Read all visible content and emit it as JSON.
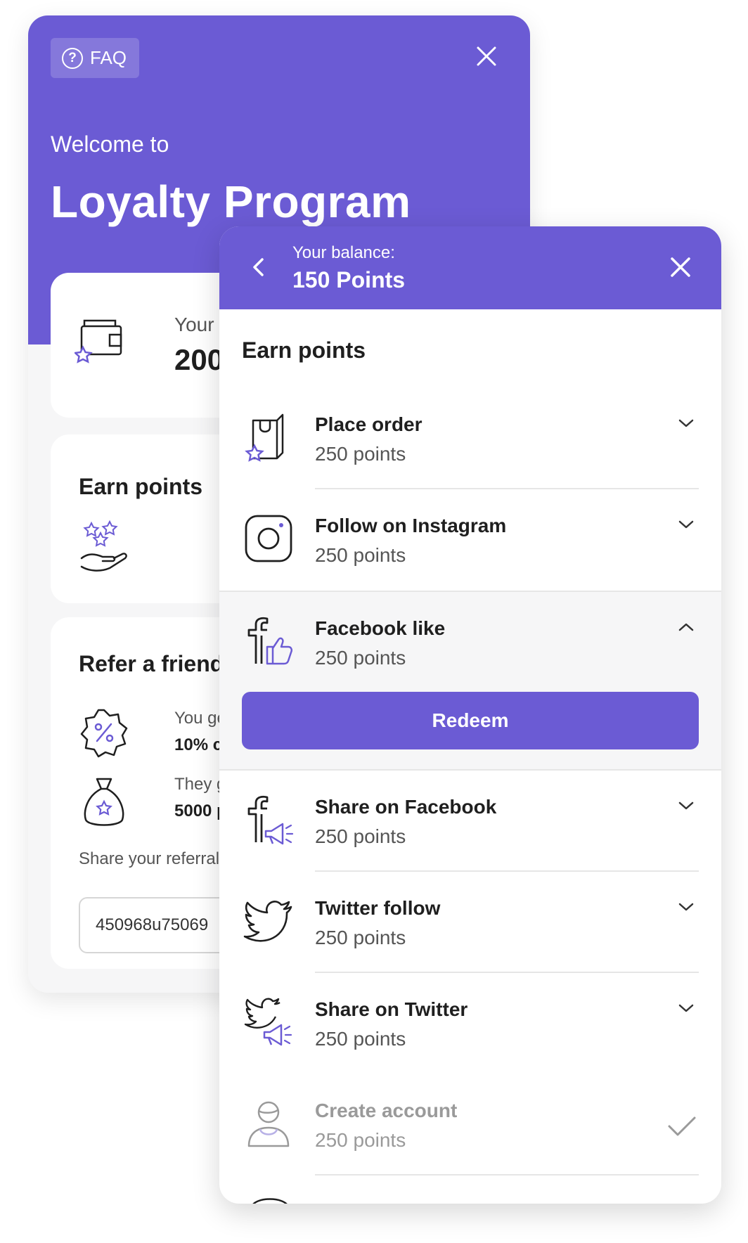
{
  "back_panel": {
    "faq_label": "FAQ",
    "welcome": "Welcome to",
    "program_title": "Loyalty Program",
    "balance_label": "Your balance",
    "balance_value": "200 Points",
    "earn_title": "Earn points",
    "refer_title": "Refer a friend",
    "you_get_label": "You get",
    "you_get_value": "10% coupon",
    "they_get_label": "They get",
    "they_get_value": "5000 points",
    "share_label": "Share your referral link",
    "referral_code": "450968u75069"
  },
  "front_panel": {
    "balance_label": "Your balance:",
    "balance_value": "150 Points",
    "section_title": "Earn points",
    "redeem_label": "Redeem",
    "items": [
      {
        "title": "Place order",
        "points": "250 points",
        "icon": "shopping-bag-star-icon"
      },
      {
        "title": "Follow on Instagram",
        "points": "250 points",
        "icon": "instagram-icon"
      },
      {
        "title": "Facebook like",
        "points": "250 points",
        "icon": "facebook-like-icon"
      },
      {
        "title": "Share on Facebook",
        "points": "250 points",
        "icon": "facebook-share-icon"
      },
      {
        "title": "Twitter follow",
        "points": "250 points",
        "icon": "twitter-icon"
      },
      {
        "title": "Share on Twitter",
        "points": "250 points",
        "icon": "twitter-share-icon"
      },
      {
        "title": "Create account",
        "points": "250 points",
        "icon": "user-account-icon"
      }
    ]
  },
  "colors": {
    "accent": "#6b5bd4",
    "text": "#1f1f1f",
    "muted": "#555555",
    "disabled": "#9a9a9a"
  }
}
